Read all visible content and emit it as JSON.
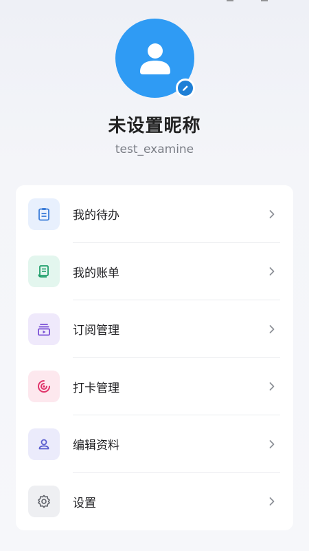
{
  "profile": {
    "nickname": "未设置昵称",
    "username": "test_examine",
    "avatar_color": "#2f9bf4",
    "avatar_icon": "user-icon",
    "edit_icon": "pencil-icon"
  },
  "menu": {
    "items": [
      {
        "label": "我的待办",
        "icon": "clipboard-icon",
        "icon_color": "#3b7dd8",
        "bg": "#e8f0fd"
      },
      {
        "label": "我的账单",
        "icon": "receipt-icon",
        "icon_color": "#1e9e6a",
        "bg": "#e3f6ee"
      },
      {
        "label": "订阅管理",
        "icon": "subscription-icon",
        "icon_color": "#7a4fd6",
        "bg": "#efe9fb"
      },
      {
        "label": "打卡管理",
        "icon": "target-icon",
        "icon_color": "#e0336a",
        "bg": "#fde8ee"
      },
      {
        "label": "编辑资料",
        "icon": "profile-icon",
        "icon_color": "#5b5fcf",
        "bg": "#ebebfb"
      },
      {
        "label": "设置",
        "icon": "gear-icon",
        "icon_color": "#5d6068",
        "bg": "#eeeff2"
      }
    ]
  }
}
